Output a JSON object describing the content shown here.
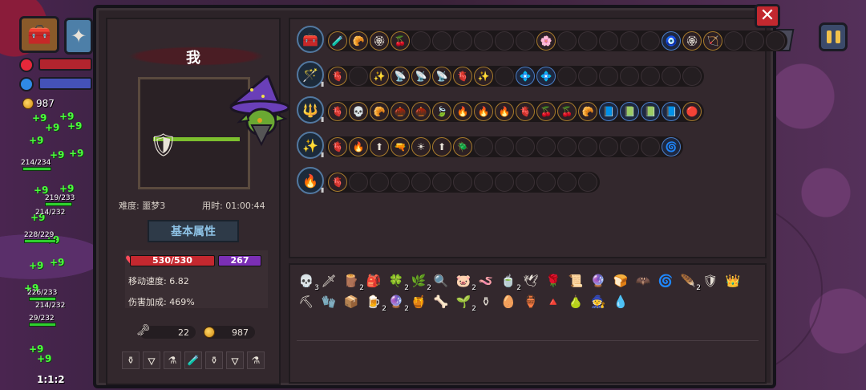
{
  "hud": {
    "gold": "987",
    "speed": "1:1:2",
    "floaters": [
      "+9",
      "+9",
      "+9",
      "+9",
      "+9",
      "+9",
      "+9",
      "+9",
      "+9",
      "+9",
      "+9",
      "+9",
      "+9",
      "+9",
      "+9",
      "+9"
    ],
    "hp_labels": [
      "214/234",
      "219/233",
      "214/232",
      "228/229",
      "226/233",
      "214/232",
      "29/232"
    ]
  },
  "panel": {
    "close_label": "✕",
    "help_label": "?",
    "character": {
      "name": "我",
      "difficulty_label": "难度: 噩梦3",
      "time_label": "用时: 01:00:44",
      "attr_tab": "基本属性",
      "hp": "530/530",
      "mp": "267",
      "move_speed": "移动速度: 6.82",
      "damage_bonus": "伤害加成: 469%",
      "keys": "22",
      "gold": "987",
      "potions": [
        "⚱",
        "🜄",
        "⚗",
        "🧪",
        "⚱",
        "🜄",
        "⚗"
      ]
    },
    "weapons": [
      {
        "icon": "chest-icon",
        "glyph": "🧰",
        "slots": [
          "🧪",
          "🥐",
          "🏵",
          "🍒",
          "",
          "",
          "",
          "",
          "",
          "",
          "🌸",
          "",
          "",
          "",
          "",
          "",
          "🧿",
          "🏵",
          "🏹",
          "",
          "",
          ""
        ]
      },
      {
        "icon": "staff-icon",
        "glyph": "🪄",
        "slots": [
          "🫀",
          "",
          "✨",
          "📡",
          "📡",
          "📡",
          "🫀",
          "✨",
          "",
          "💠",
          "💠",
          "",
          "",
          "",
          "",
          "",
          "",
          ""
        ]
      },
      {
        "icon": "scepter-icon",
        "glyph": "🔱",
        "slots": [
          "🫀",
          "💀",
          "🥐",
          "🌰",
          "🌰",
          "🍃",
          "🔥",
          "🔥",
          "🔥",
          "🫀",
          "🍒",
          "🍒",
          "🥐",
          "📘",
          "📗",
          "📗",
          "📘",
          "🔴"
        ]
      },
      {
        "icon": "wand-icon",
        "glyph": "✨",
        "slots": [
          "🫀",
          "🔥",
          "⬆",
          "🔫",
          "☀",
          "⬆",
          "🪲",
          "",
          "",
          "",
          "",
          "",
          "",
          "",
          "",
          "",
          "🌀"
        ]
      },
      {
        "icon": "torch-icon",
        "glyph": "🔥",
        "slots": [
          "🫀",
          "",
          "",
          "",
          "",
          "",
          "",
          "",
          "",
          "",
          "",
          "",
          ""
        ]
      }
    ],
    "relics": [
      {
        "g": "💀",
        "n": "3"
      },
      {
        "g": "🗡",
        "n": ""
      },
      {
        "g": "🪵",
        "n": "2"
      },
      {
        "g": "🎒",
        "n": ""
      },
      {
        "g": "🍀",
        "n": "2"
      },
      {
        "g": "🌿",
        "n": "2"
      },
      {
        "g": "🔍",
        "n": ""
      },
      {
        "g": "🐷",
        "n": "2"
      },
      {
        "g": "🪱",
        "n": ""
      },
      {
        "g": "🍵",
        "n": "2"
      },
      {
        "g": "🕊",
        "n": ""
      },
      {
        "g": "🌹",
        "n": ""
      },
      {
        "g": "📜",
        "n": ""
      },
      {
        "g": "🔮",
        "n": ""
      },
      {
        "g": "🍞",
        "n": ""
      },
      {
        "g": "🦇",
        "n": ""
      },
      {
        "g": "🌀",
        "n": ""
      },
      {
        "g": "🪶",
        "n": "2"
      },
      {
        "g": "🛡",
        "n": ""
      },
      {
        "g": "👑",
        "n": ""
      },
      {
        "g": "⛏",
        "n": ""
      },
      {
        "g": "🧤",
        "n": ""
      },
      {
        "g": "📦",
        "n": ""
      },
      {
        "g": "🍺",
        "n": "2"
      },
      {
        "g": "🔮",
        "n": "2"
      },
      {
        "g": "🍯",
        "n": ""
      },
      {
        "g": "🦴",
        "n": ""
      },
      {
        "g": "🌱",
        "n": "2"
      },
      {
        "g": "⚱",
        "n": ""
      },
      {
        "g": "🥚",
        "n": ""
      },
      {
        "g": "🏺",
        "n": ""
      },
      {
        "g": "🔺",
        "n": ""
      },
      {
        "g": "🍐",
        "n": ""
      },
      {
        "g": "🧙",
        "n": ""
      },
      {
        "g": "💧",
        "n": ""
      }
    ]
  }
}
